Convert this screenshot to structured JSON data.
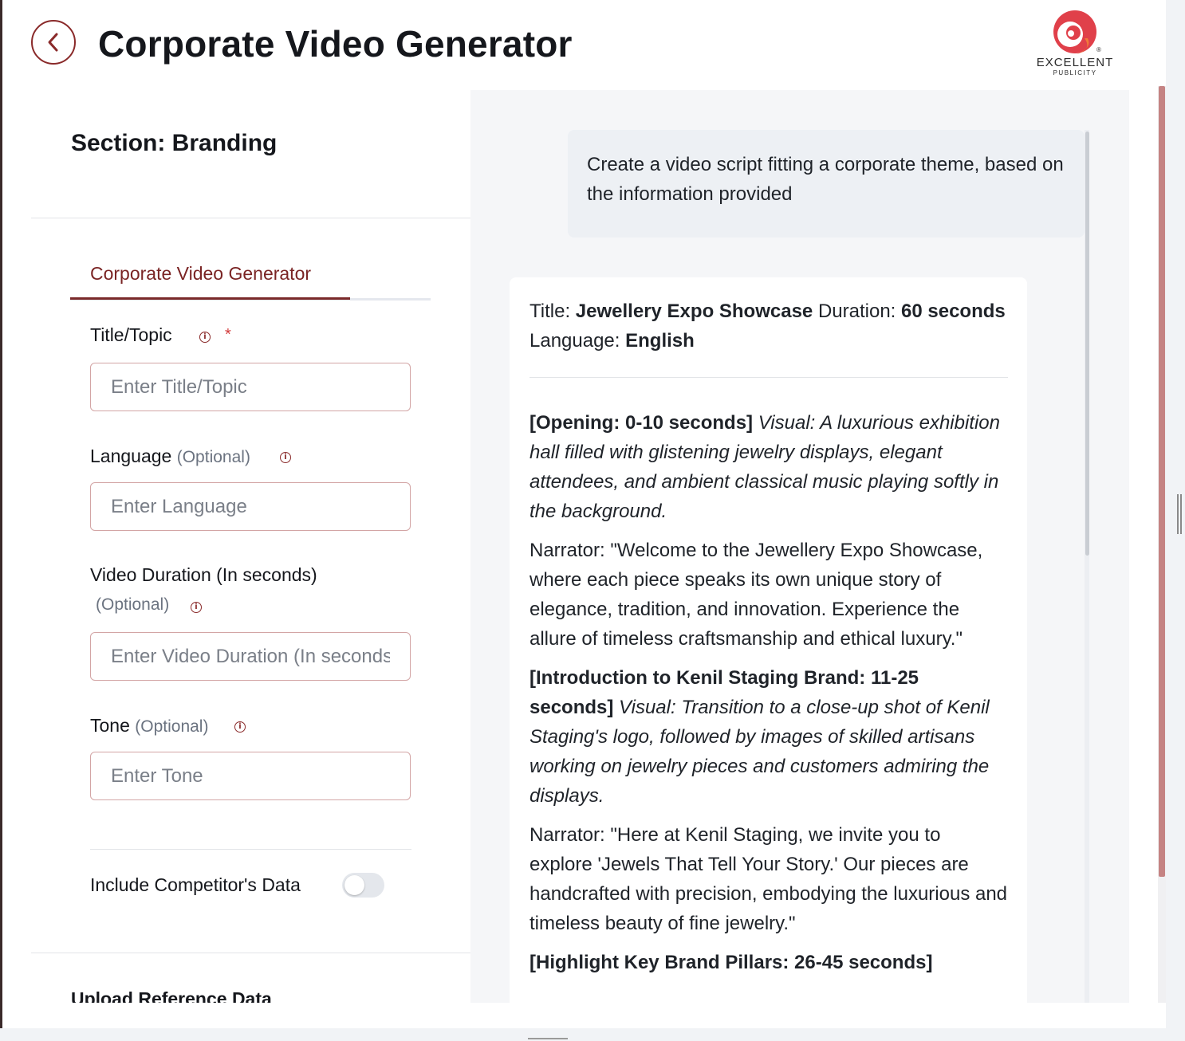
{
  "header": {
    "title": "Corporate Video Generator",
    "logo": {
      "name": "EXCELLENT",
      "sub": "PUBLICITY",
      "registered": "®"
    }
  },
  "section": {
    "title": "Section: Branding"
  },
  "tabs": [
    {
      "label": "Corporate Video Generator",
      "active": true
    }
  ],
  "form": {
    "title": {
      "label": "Title/Topic",
      "required_mark": "*",
      "placeholder": "Enter Title/Topic",
      "value": ""
    },
    "language": {
      "label": "Language",
      "optional": "(Optional)",
      "placeholder": "Enter Language",
      "value": ""
    },
    "duration": {
      "label": "Video Duration (In seconds)",
      "optional": "(Optional)",
      "placeholder": "Enter Video Duration (In seconds)",
      "value": ""
    },
    "tone": {
      "label": "Tone",
      "optional": "(Optional)",
      "placeholder": "Enter Tone",
      "value": ""
    },
    "competitor": {
      "label": "Include Competitor's Data",
      "enabled": false
    },
    "upload_label": "Upload Reference Data"
  },
  "prompt": {
    "text": "Create a video script fitting a corporate theme, based on the information provided"
  },
  "response": {
    "meta": {
      "title_label": "Title:",
      "title_value": "Jewellery Expo Showcase",
      "duration_label": "Duration:",
      "duration_value": "60 seconds",
      "language_label": "Language:",
      "language_value": "English"
    },
    "opening": {
      "heading": "[Opening: 0-10 seconds]",
      "visual": "Visual: A luxurious exhibition hall filled with glistening jewelry displays, elegant attendees, and ambient classical music playing softly in the background.",
      "narration": "Narrator: \"Welcome to the Jewellery Expo Showcase, where each piece speaks its own unique story of elegance, tradition, and innovation. Experience the allure of timeless craftsmanship and ethical luxury.\""
    },
    "introduction": {
      "heading": "[Introduction to Kenil Staging Brand: 11-25 seconds]",
      "visual": "Visual: Transition to a close-up shot of Kenil Staging's logo, followed by images of skilled artisans working on jewelry pieces and customers admiring the displays.",
      "narration": "Narrator: \"Here at Kenil Staging, we invite you to explore 'Jewels That Tell Your Story.' Our pieces are handcrafted with precision, embodying the luxurious and timeless beauty of fine jewelry.\""
    },
    "pillars": {
      "heading": "[Highlight Key Brand Pillars: 26-45 seconds]"
    }
  },
  "colors": {
    "accent": "#7a2a2a",
    "scroll_thumb": "#c58383",
    "input_border": "#d3a5a5"
  }
}
